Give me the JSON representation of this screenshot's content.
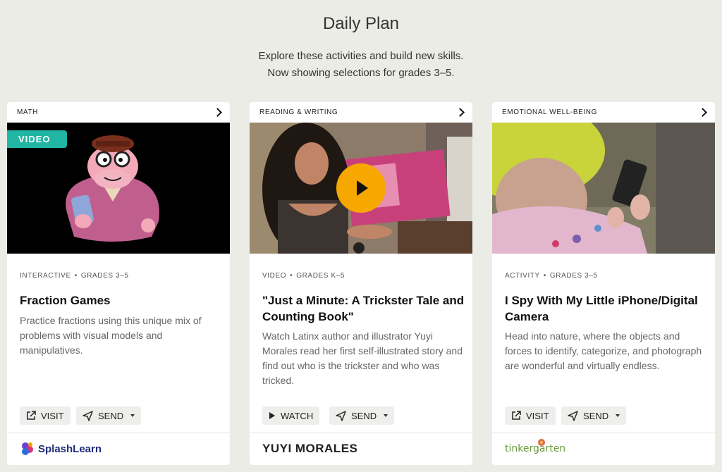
{
  "page": {
    "title": "Daily Plan",
    "intro_line1": "Explore these activities and build new skills.",
    "intro_line2": "Now showing selections for grades 3–5."
  },
  "cards": [
    {
      "category": "MATH",
      "badge": "VIDEO",
      "type": "INTERACTIVE",
      "grades": "GRADES 3–5",
      "title": "Fraction Games",
      "description": "Practice fractions using this unique mix of problems with visual models and manipulatives.",
      "primary_action": "VISIT",
      "primary_icon": "external-link-icon",
      "secondary_action": "SEND",
      "partner": "SplashLearn"
    },
    {
      "category": "READING & WRITING",
      "type": "VIDEO",
      "grades": "GRADES K–5",
      "title": "\"Just a Minute: A Trickster Tale and Counting Book\"",
      "description": "Watch Latinx author and illustrator Yuyi Morales read her first self-illustrated story and find out who is the trickster and who was tricked.",
      "primary_action": "WATCH",
      "primary_icon": "play-icon",
      "secondary_action": "SEND",
      "partner": "YUYI MORALES"
    },
    {
      "category": "EMOTIONAL WELL-BEING",
      "type": "ACTIVITY",
      "grades": "GRADES 3–5",
      "title": "I Spy With My Little iPhone/Digital Camera",
      "description": "Head into nature, where the objects and forces to identify, categorize, and photograph are wonderful and virtually endless.",
      "primary_action": "VISIT",
      "primary_icon": "external-link-icon",
      "secondary_action": "SEND",
      "partner": "tinkergarten"
    }
  ],
  "colors": {
    "background": "#ecece6",
    "video_badge": "#21b5a3",
    "play_button": "#f6a700",
    "splash_text": "#1e2a78",
    "tinker_text": "#6a9a3c"
  }
}
